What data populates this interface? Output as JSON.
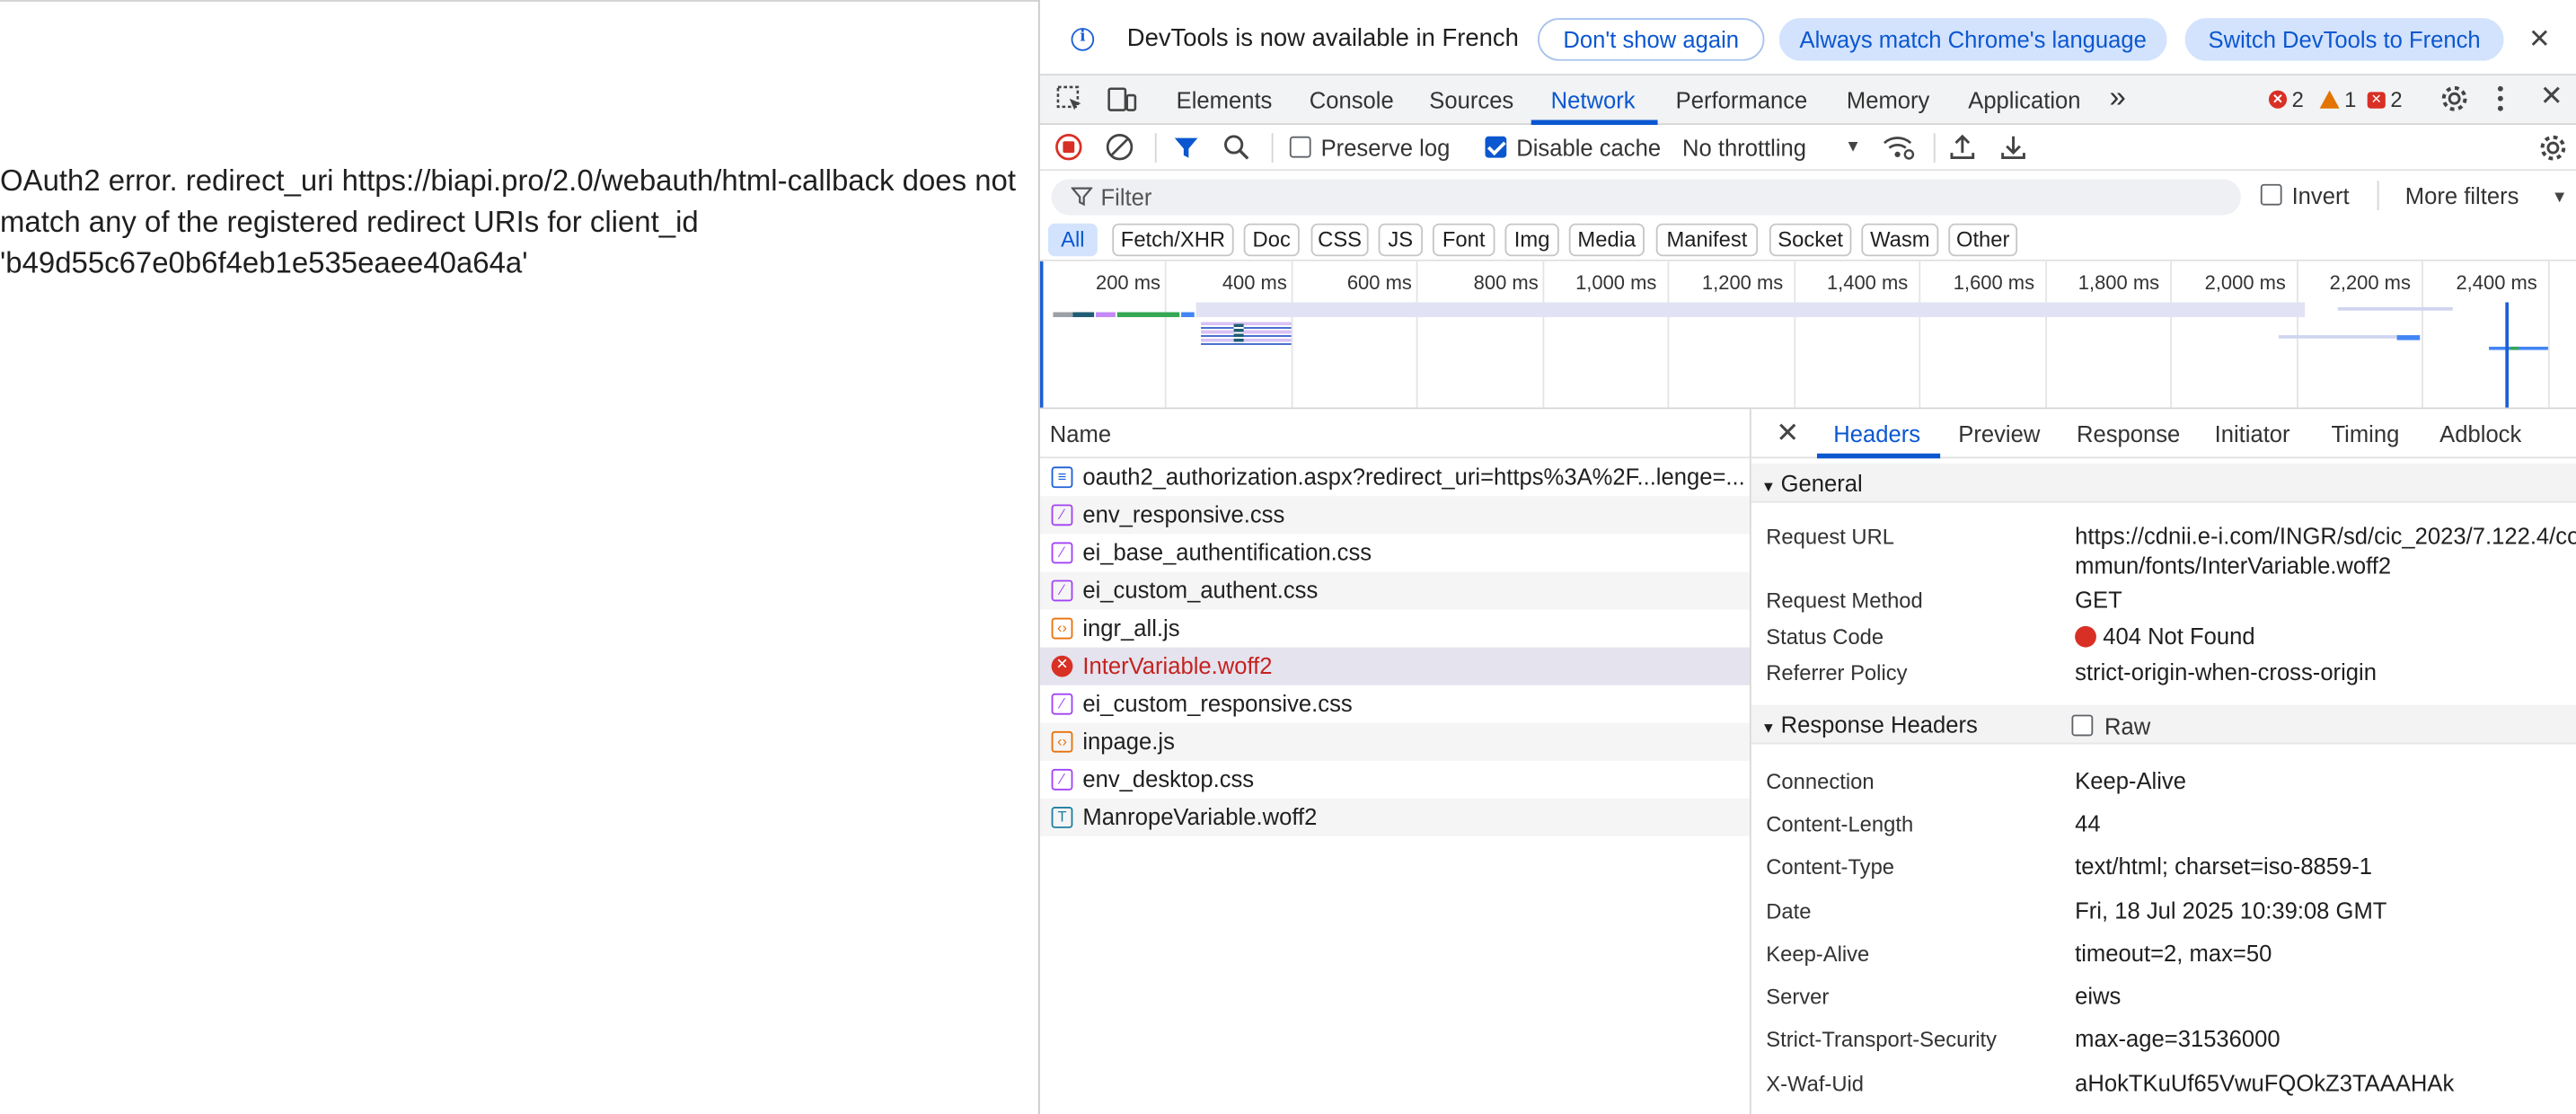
{
  "page": {
    "error_message": "OAuth2 error. redirect_uri https://biapi.pro/2.0/webauth/html-callback does not match any of the registered redirect URIs for client_id 'b49d55c67e0b6f4eb1e535eaee40a64a'"
  },
  "infobar": {
    "text": "DevTools is now available in French",
    "dont_show": "Don't show again",
    "match_lang": "Always match Chrome's language",
    "switch": "Switch DevTools to French",
    "close": "✕"
  },
  "tabs": [
    "Elements",
    "Console",
    "Sources",
    "Network",
    "Performance",
    "Memory",
    "Application"
  ],
  "active_tab": "Network",
  "more_tabs": "»",
  "counts": {
    "errors": "2",
    "warnings": "1",
    "issues": "2"
  },
  "toolbar": {
    "preserve_log": "Preserve log",
    "preserve_log_checked": false,
    "disable_cache": "Disable cache",
    "disable_cache_checked": true,
    "throttling": "No throttling"
  },
  "filter": {
    "placeholder": "Filter",
    "invert": "Invert",
    "more_filters": "More filters"
  },
  "types": [
    "All",
    "Fetch/XHR",
    "Doc",
    "CSS",
    "JS",
    "Font",
    "Img",
    "Media",
    "Manifest",
    "Socket",
    "Wasm",
    "Other"
  ],
  "active_type": "All",
  "timeline": {
    "ticks": [
      "200 ms",
      "400 ms",
      "600 ms",
      "800 ms",
      "1,000 ms",
      "1,200 ms",
      "1,400 ms",
      "1,600 ms",
      "1,800 ms",
      "2,000 ms",
      "2,200 ms",
      "2,400 ms"
    ]
  },
  "list": {
    "header": "Name",
    "requests": [
      {
        "name": "oauth2_authorization.aspx?redirect_uri=https%3A%2F...lenge=...",
        "type": "doc"
      },
      {
        "name": "env_responsive.css",
        "type": "css"
      },
      {
        "name": "ei_base_authentification.css",
        "type": "css"
      },
      {
        "name": "ei_custom_authent.css",
        "type": "css"
      },
      {
        "name": "ingr_all.js",
        "type": "js"
      },
      {
        "name": "InterVariable.woff2",
        "type": "error"
      },
      {
        "name": "ei_custom_responsive.css",
        "type": "css"
      },
      {
        "name": "inpage.js",
        "type": "js"
      },
      {
        "name": "env_desktop.css",
        "type": "css"
      },
      {
        "name": "ManropeVariable.woff2",
        "type": "font"
      }
    ]
  },
  "detail": {
    "close": "✕",
    "tabs": [
      "Headers",
      "Preview",
      "Response",
      "Initiator",
      "Timing",
      "Adblock"
    ],
    "active_tab": "Headers",
    "general_title": "General",
    "general": [
      {
        "key": "Request URL",
        "value": "https://cdnii.e-i.com/INGR/sd/cic_2023/7.122.4/co",
        "value2": "mmun/fonts/InterVariable.woff2"
      },
      {
        "key": "Request Method",
        "value": "GET"
      },
      {
        "key": "Status Code",
        "value": "404 Not Found"
      },
      {
        "key": "Referrer Policy",
        "value": "strict-origin-when-cross-origin"
      }
    ],
    "response_title": "Response Headers",
    "raw": "Raw",
    "response": [
      {
        "key": "Connection",
        "value": "Keep-Alive"
      },
      {
        "key": "Content-Length",
        "value": "44"
      },
      {
        "key": "Content-Type",
        "value": "text/html; charset=iso-8859-1"
      },
      {
        "key": "Date",
        "value": "Fri, 18 Jul 2025 10:39:08 GMT"
      },
      {
        "key": "Keep-Alive",
        "value": "timeout=2, max=50"
      },
      {
        "key": "Server",
        "value": "eiws"
      },
      {
        "key": "Strict-Transport-Security",
        "value": "max-age=31536000"
      },
      {
        "key": "X-Waf-Uid",
        "value": "aHokTKuUf65VwuFQOkZ3TAAAHAk"
      }
    ]
  },
  "icons": {
    "inspect": "inspect-element-icon",
    "device": "device-toolbar-icon",
    "settings": "gear-icon",
    "kebab": "more-vertical-icon",
    "record": "stop-recording-icon",
    "clear": "clear-icon",
    "filter": "filter-icon",
    "search": "search-icon"
  },
  "colors": {
    "accent": "#0b57d0",
    "error": "#d93025",
    "warning": "#e37400"
  }
}
